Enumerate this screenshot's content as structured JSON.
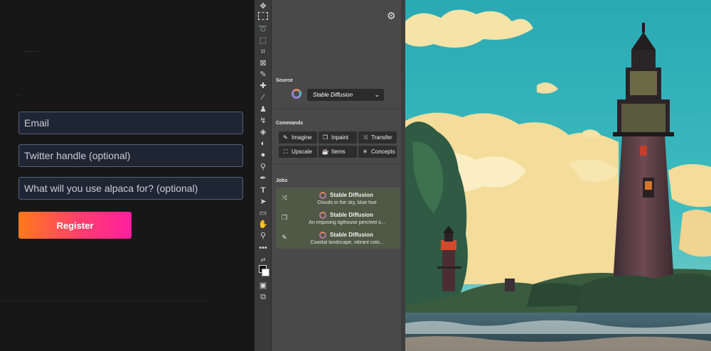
{
  "form": {
    "email_placeholder": "Email",
    "twitter_placeholder": "Twitter handle (optional)",
    "usage_placeholder": "What will you use alpaca for? (optional)",
    "register_label": "Register"
  },
  "panel": {
    "source_heading": "Source",
    "source_value": "Stable Diffusion",
    "commands_heading": "Commands",
    "commands": [
      {
        "label": "Imagine",
        "icon": "pencil-icon"
      },
      {
        "label": "Inpaint",
        "icon": "layers-icon"
      },
      {
        "label": "Transfer",
        "icon": "shuffle-icon"
      },
      {
        "label": "Upscale",
        "icon": "expand-icon"
      },
      {
        "label": "Items",
        "icon": "teapot-icon"
      },
      {
        "label": "Concepts",
        "icon": "sparkle-icon"
      }
    ],
    "jobs_heading": "Jobs",
    "jobs": [
      {
        "title": "Stable Diffusion",
        "desc": "Clouds in the sky, blue hue",
        "icon": "shuffle-icon"
      },
      {
        "title": "Stable Diffusion",
        "desc": "An imposing ligthouse perched o...",
        "icon": "layers-icon"
      },
      {
        "title": "Stable Diffusion",
        "desc": "Coastal landscape, vibrant colo...",
        "icon": "pencil-icon"
      }
    ]
  },
  "colors": {
    "register_gradient_start": "#ff7a1a",
    "register_gradient_end": "#ff1f9e",
    "jobs_background": "#4f5946",
    "panel_background": "#494949"
  }
}
